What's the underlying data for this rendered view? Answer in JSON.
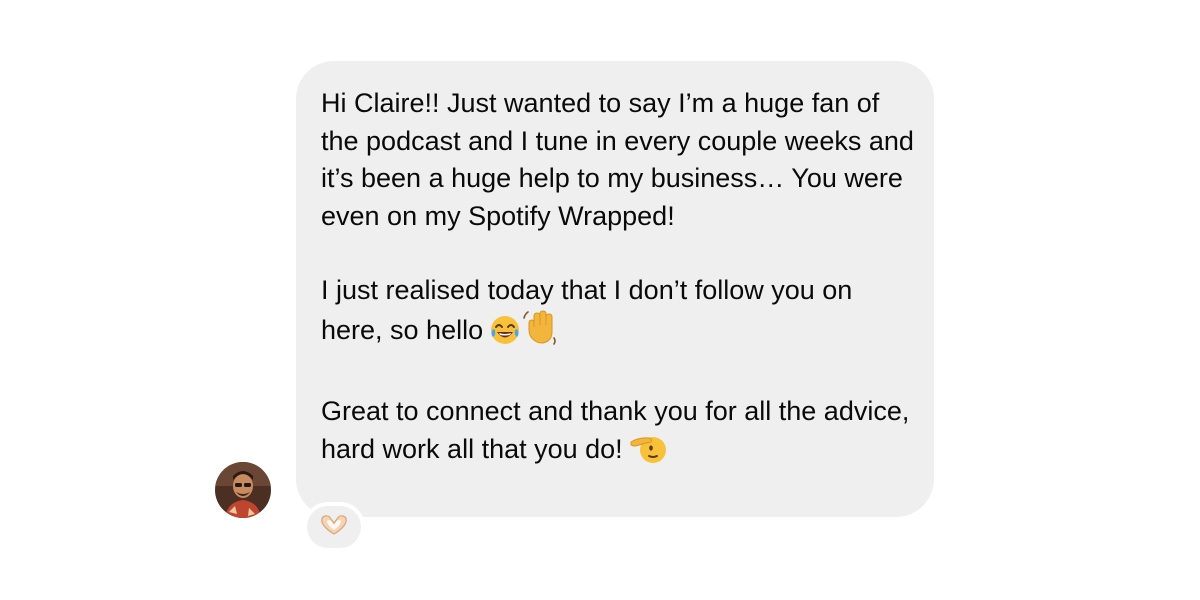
{
  "message": {
    "paragraphs": [
      "Hi Claire!! Just wanted to say I’m a huge fan of the podcast and I tune in every couple weeks and it’s been a huge help to my business… You were even on my Spotify Wrapped!",
      "I just realised today that I don’t follow you on here, so hello",
      "Great to connect and thank you for all the advice, hard work all that you do!"
    ],
    "inline_emojis": {
      "p2": [
        "laughing-tears-emoji",
        "waving-hand-emoji"
      ],
      "p3": [
        "saluting-face-emoji"
      ]
    }
  },
  "sender": {
    "avatar": "avatar-photo"
  },
  "reaction": {
    "icon": "heart-hands-emoji"
  },
  "colors": {
    "bubble": "#efefef",
    "text": "#0a0a0a",
    "background": "#ffffff"
  }
}
